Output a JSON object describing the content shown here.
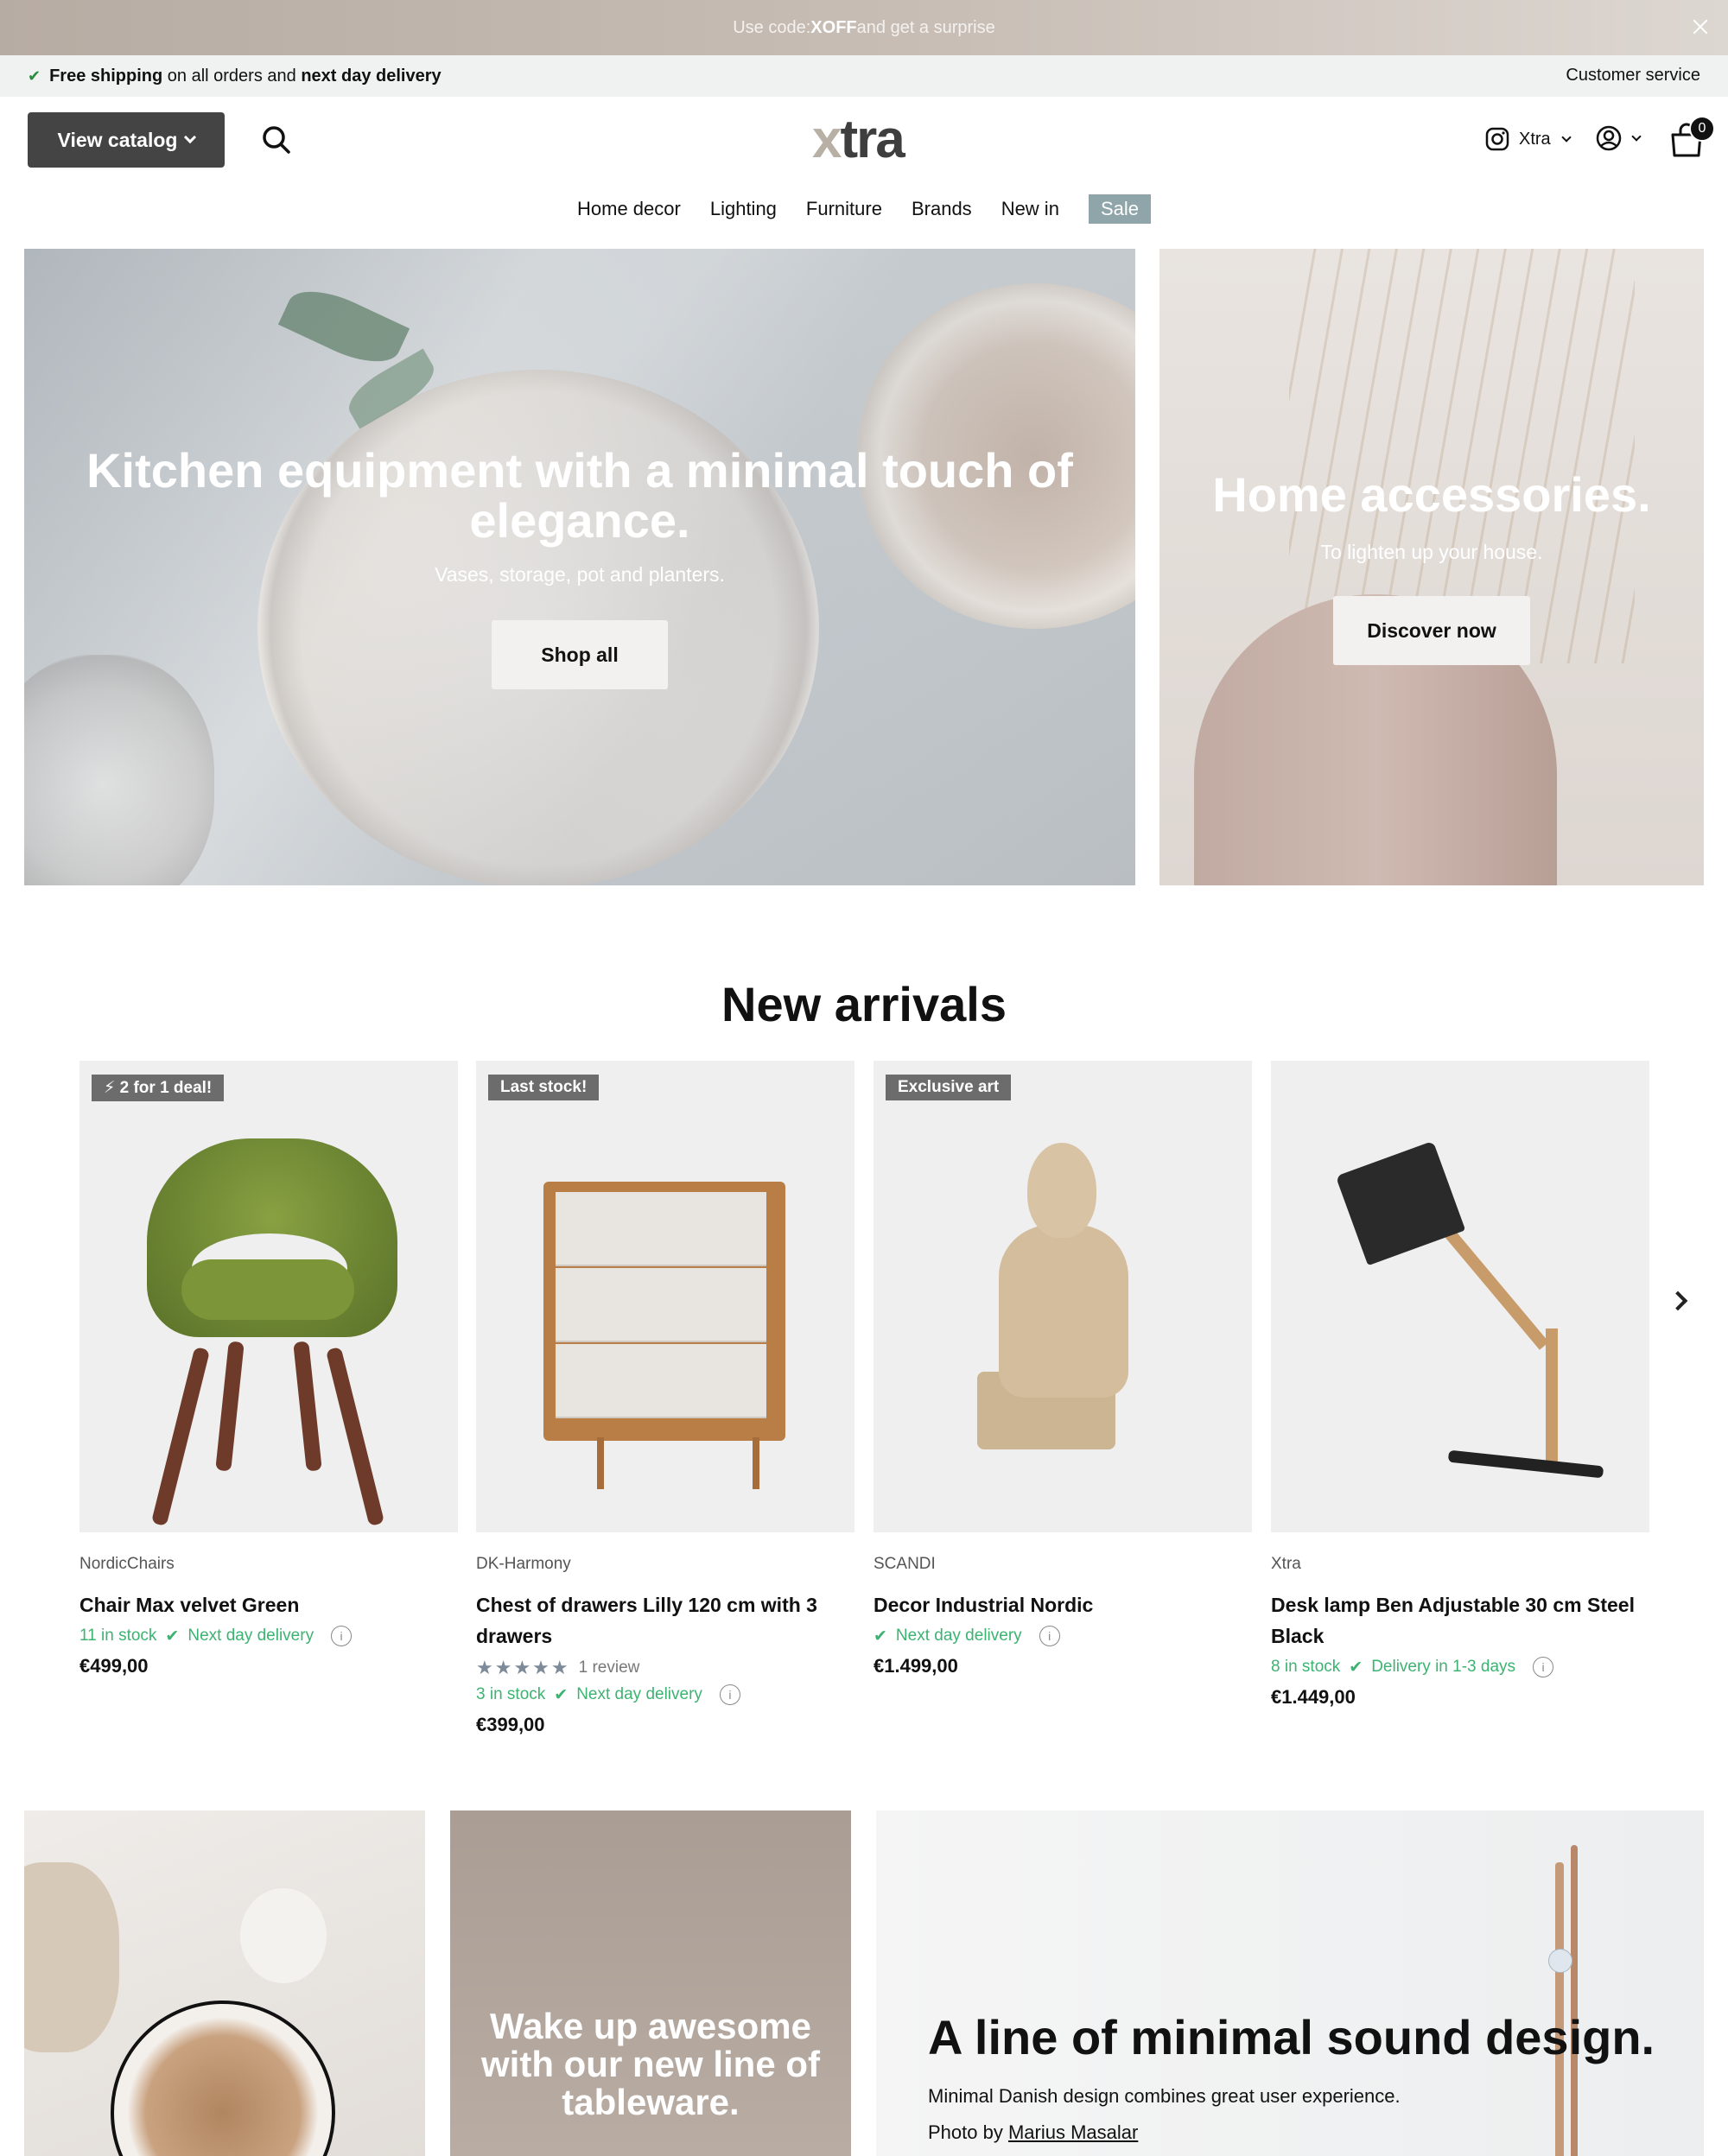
{
  "announcement": {
    "prefix": "Use code: ",
    "code": "XOFF",
    "suffix": " and get a surprise"
  },
  "usp": {
    "part1": "Free shipping",
    "part2": " on all orders and ",
    "part3": "next day delivery",
    "customer_service": "Customer service"
  },
  "header": {
    "catalog_label": "View catalog",
    "logo_x": "x",
    "logo_rest": "tra",
    "instagram_label": "Xtra",
    "cart_count": "0"
  },
  "nav": {
    "items": [
      "Home decor",
      "Lighting",
      "Furniture",
      "Brands",
      "New in",
      "Sale"
    ]
  },
  "hero_main": {
    "title": "Kitchen equipment with a minimal touch of elegance.",
    "subtitle": "Vases, storage, pot and planters.",
    "button": "Shop all"
  },
  "hero_side": {
    "title": "Home accessories.",
    "subtitle": "To lighten up your house.",
    "button": "Discover now"
  },
  "new_arrivals": {
    "title": "New arrivals",
    "products": [
      {
        "badge": "⚡ 2 for 1 deal!",
        "vendor": "NordicChairs",
        "title": "Chair Max velvet Green",
        "stock": "11 in stock",
        "delivery": "Next day delivery",
        "price": "€499,00"
      },
      {
        "badge": "Last stock!",
        "vendor": "DK-Harmony",
        "title": "Chest of drawers Lilly 120 cm with 3 drawers",
        "stars": "★★★★★",
        "reviews": "1 review",
        "stock": "3 in stock",
        "delivery": "Next day delivery",
        "price": "€399,00"
      },
      {
        "badge": "Exclusive art",
        "vendor": "SCANDI",
        "title": "Decor Industrial Nordic",
        "stock": "",
        "delivery": "Next day delivery",
        "price": "€1.499,00"
      },
      {
        "badge": "",
        "vendor": "Xtra",
        "title": "Desk lamp Ben Adjustable 30 cm Steel Black",
        "stock": "8 in stock",
        "delivery": "Delivery in 1-3 days",
        "price": "€1.449,00"
      }
    ]
  },
  "tile_tableware": {
    "title": "Wake up awesome with our new line of tableware."
  },
  "tile_sound": {
    "title": "A line of minimal sound design.",
    "text": "Minimal Danish design combines great user experience.",
    "photo_prefix": "Photo by ",
    "photo_credit": "Marius Masalar"
  },
  "colors": {
    "accent_sale": "#8fa5aa",
    "stock_green": "#3cb371",
    "catalog_button": "#444444"
  },
  "icons": [
    "close-icon",
    "check-icon",
    "search-icon",
    "instagram-icon",
    "account-icon",
    "cart-icon",
    "info-icon",
    "chevron-right-icon"
  ]
}
